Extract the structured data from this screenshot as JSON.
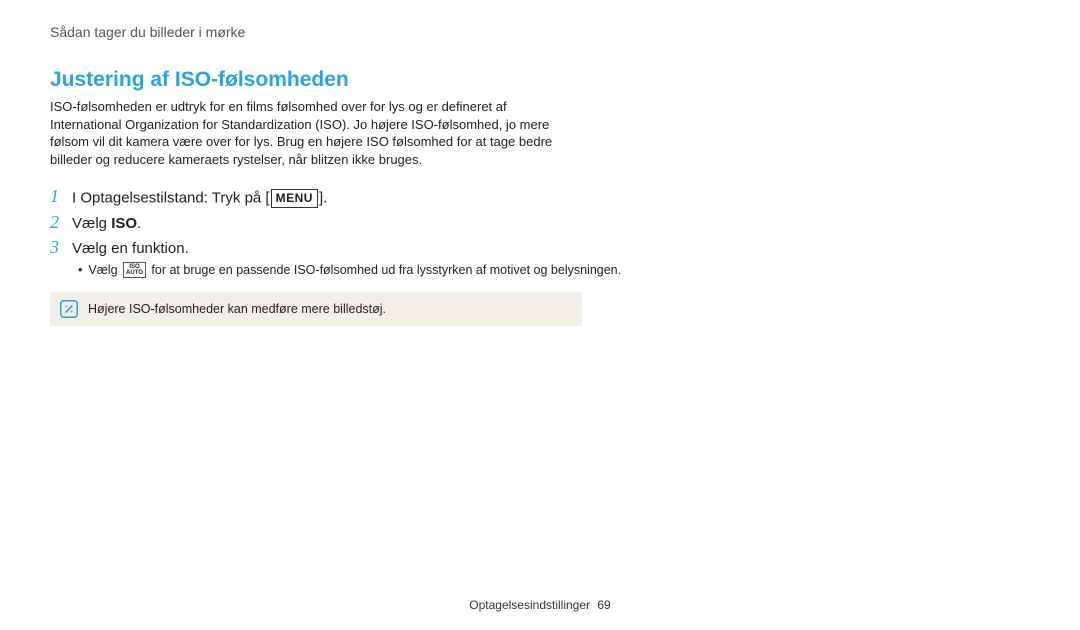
{
  "breadcrumb": "Sådan tager du billeder i mørke",
  "section_title": "Justering af ISO-følsomheden",
  "intro": "ISO-følsomheden er udtryk for en films følsomhed over for lys og er defineret af International Organization for Standardization (ISO). Jo højere ISO-følsomhed, jo mere følsom vil dit kamera være over for lys. Brug en højere ISO følsomhed for at tage bedre billeder og reducere kameraets rystelser, når blitzen ikke bruges.",
  "steps": {
    "s1_prefix": "I Optagelsestilstand: Tryk på [",
    "s1_menu": "MENU",
    "s1_suffix": "].",
    "s2_prefix": "Vælg ",
    "s2_bold": "ISO",
    "s2_suffix": ".",
    "s3": "Vælg en funktion."
  },
  "bullet": {
    "prefix": "Vælg ",
    "iso_top": "ISO",
    "iso_bot": "AUTO",
    "suffix": " for at bruge en passende ISO-følsomhed ud fra lysstyrken af motivet og belysningen."
  },
  "note": "Højere ISO-følsomheder kan medføre mere billedstøj.",
  "footer_label": "Optagelsesindstillinger",
  "footer_page": "69"
}
